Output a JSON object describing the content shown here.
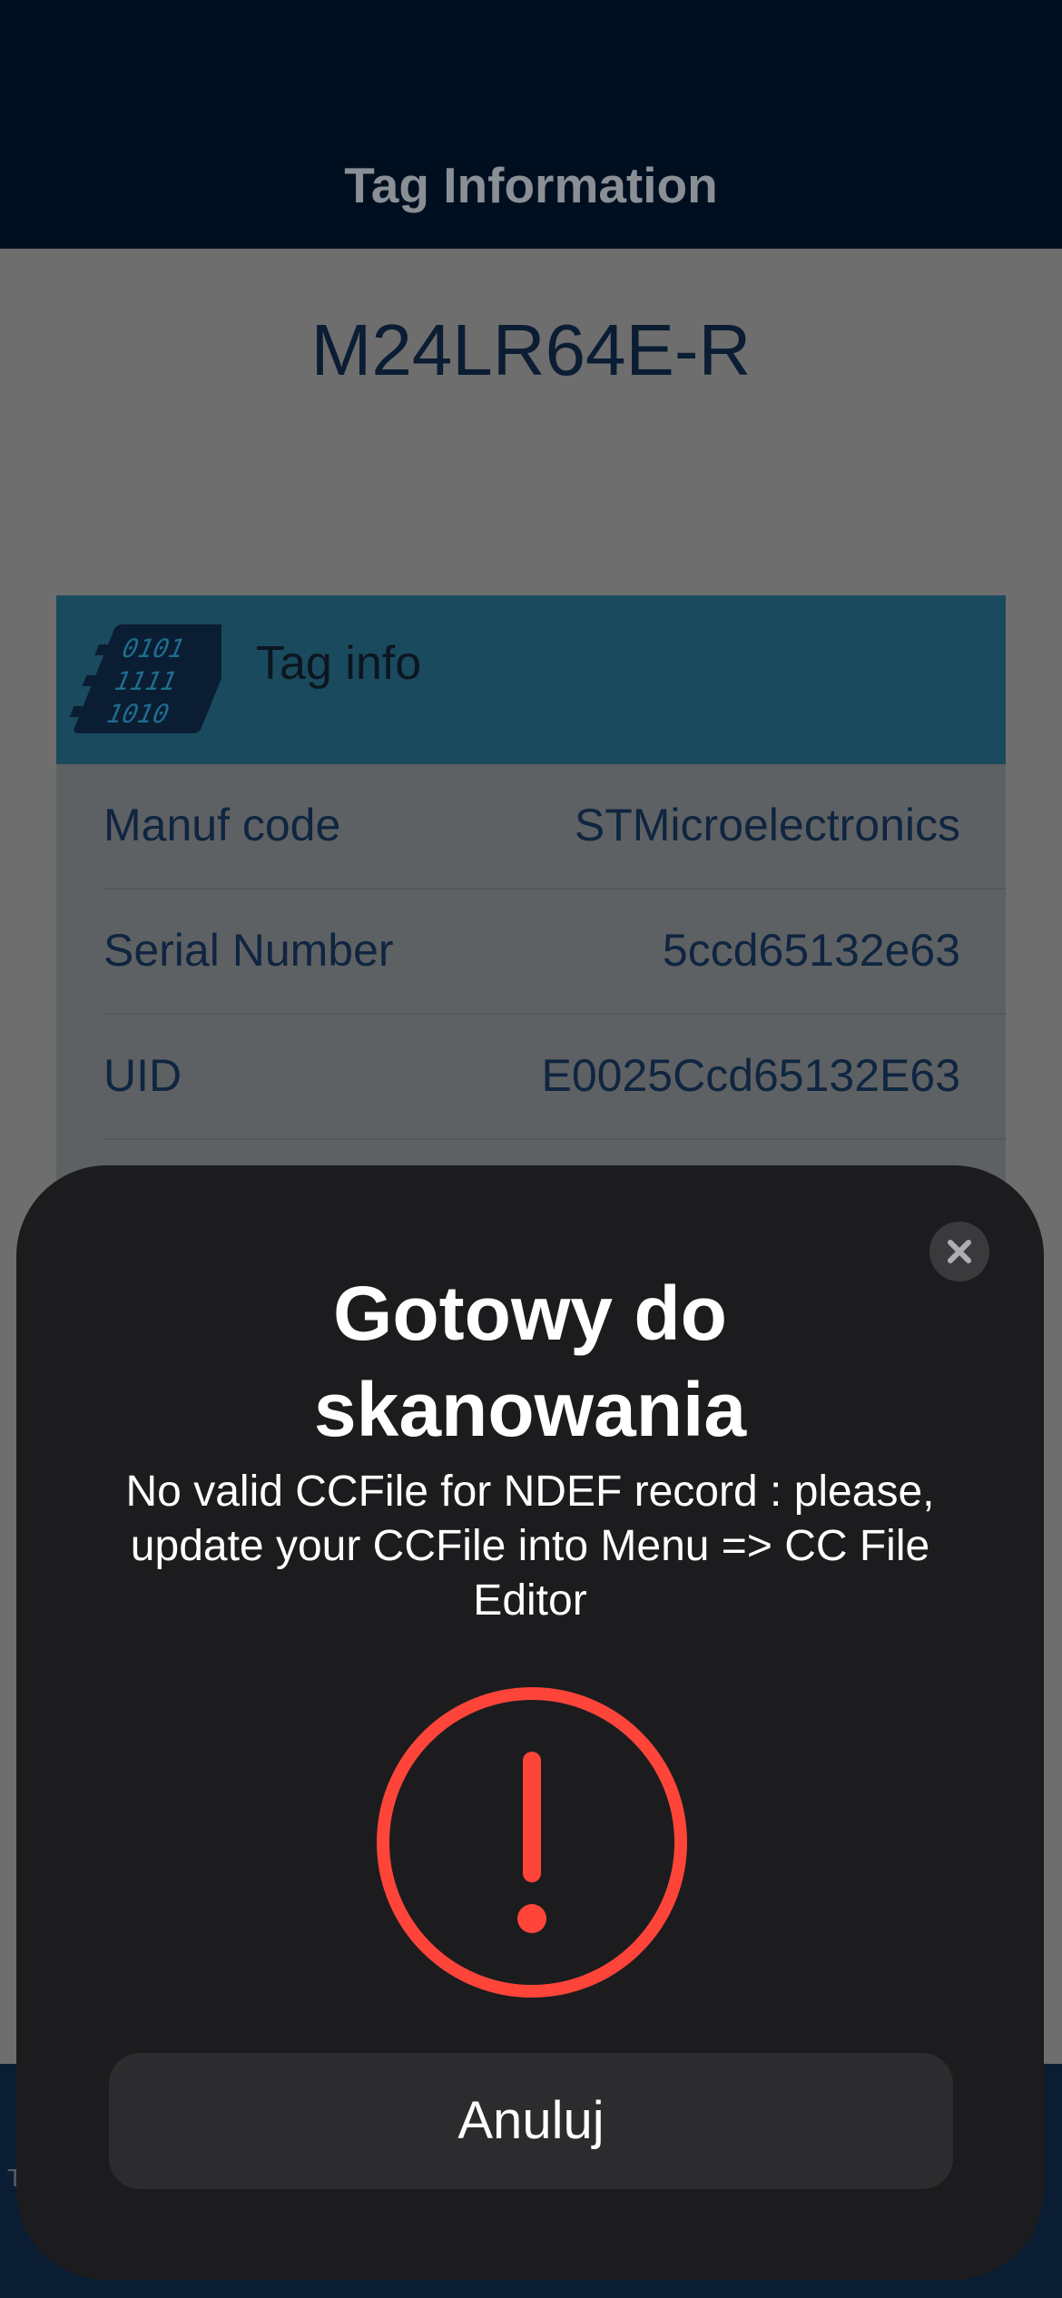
{
  "header": {
    "title": "Tag Information"
  },
  "tag": {
    "name": "M24LR64E-R"
  },
  "card": {
    "title": "Tag info",
    "chip_text": [
      "0101",
      "1111",
      "1010"
    ],
    "rows": [
      {
        "label": "Manuf code",
        "value": "STMicroelectronics"
      },
      {
        "label": "Serial Number",
        "value": "5ccd65132e63"
      },
      {
        "label": "UID",
        "value": "E0025Ccd65132E63"
      }
    ]
  },
  "bottom": {
    "glyph": "T"
  },
  "sheet": {
    "title_line1": "Gotowy do",
    "title_line2": "skanowania",
    "message_line1": "No valid CCFile for NDEF record : please,",
    "message_line2": "update your CCFile into Menu => CC File",
    "message_line3": "Editor",
    "cancel_label": "Anuluj",
    "close_icon": "close-icon",
    "status_icon": "exclamation-circle-icon",
    "status_color": "#ff453a"
  }
}
